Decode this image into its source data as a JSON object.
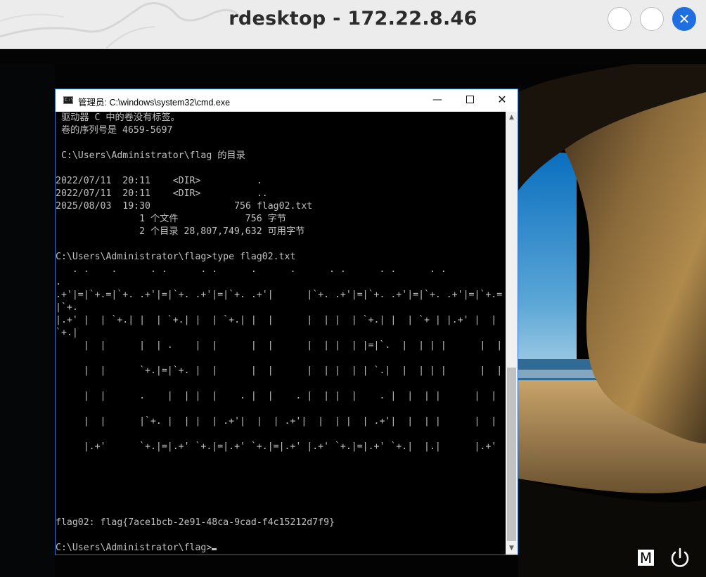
{
  "window": {
    "title": "rdesktop - 172.22.8.46",
    "buttons": {
      "minimize": "",
      "maximize": "",
      "close": "✕"
    }
  },
  "cmd_window": {
    "title": "管理员: C:\\windows\\system32\\cmd.exe",
    "icon_text": "C:\\",
    "controls": {
      "minimize": "—",
      "maximize": "",
      "close": "✕"
    }
  },
  "terminal": {
    "lines": [
      " 驱动器 C 中的卷没有标签。",
      " 卷的序列号是 4659-5697",
      "",
      " C:\\Users\\Administrator\\flag 的目录",
      "",
      "2022/07/11  20:11    <DIR>          .",
      "2022/07/11  20:11    <DIR>          ..",
      "2025/08/03  19:30               756 flag02.txt",
      "               1 个文件            756 字节",
      "               2 个目录 28,807,749,632 可用字节",
      "",
      "C:\\Users\\Administrator\\flag>type flag02.txt",
      "   . .    .      . .      . .      .      .      . .      . .      . .",
      ".",
      ".+'|=|`+.=|`+. .+'|=|`+. .+'|=|`+. .+'|      |`+. .+'|=|`+. .+'|=|`+. .+'|=|`+.=",
      "|`+.",
      "|.+' |  | `+.| |  | `+.| |  | `+.| |  |      |  | |  | `+.| |  | `+ | |.+' |  |",
      "`+.|",
      "     |  |      |  | .    |  |      |  |      |  | |  | |=|`.  |  | | |      |  |",
      "",
      "     |  |      `+.|=|`+. |  |      |  |      |  | |  | | `.|  |  | | |      |  |",
      "",
      "     |  |      .    |  | |  |    . |  |    . |  | |  |    . |  |  | |      |  |",
      "",
      "     |  |      |`+. |  | |  | .+'|  |  | .+'|  |  | |  | .+'|  |  | |      |  |",
      "",
      "     |.+'      `+.|=|.+' `+.|=|.+' `+.|=|.+' |.+' `+.|=|.+' `+.|  |.|      |.+'",
      "",
      "",
      "",
      "",
      "",
      "flag02: flag{7ace1bcb-2e91-48ca-9cad-f4c15212d7f9}",
      ""
    ],
    "prompt": "C:\\Users\\Administrator\\flag>"
  },
  "scrollbar": {
    "up": "▲",
    "down": "▼"
  },
  "tray": {
    "m_label": "M"
  },
  "icons": {
    "cmd_icon": "terminal-icon",
    "power_icon": "power-icon",
    "m_icon": "m-icon"
  }
}
